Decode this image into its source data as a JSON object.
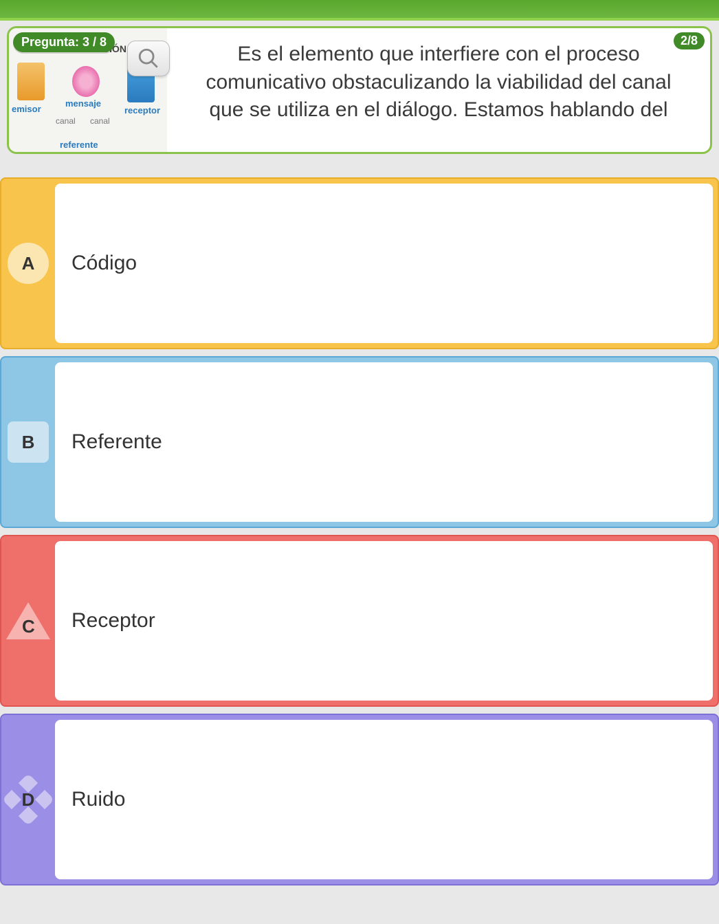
{
  "header": {
    "question_badge": "Pregunta: 3 / 8",
    "count_badge": "2/8"
  },
  "question": {
    "text": "Es el elemento que interfiere con el proceso comunicativo obstaculizando la viabilidad del canal que se utiliza en el diálogo. Estamos hablando del",
    "image": {
      "title": "COMUNICACIÓN",
      "labels": {
        "emisor": "emisor",
        "mensaje": "mensaje",
        "receptor": "receptor",
        "referente": "referente",
        "canal1": "canal",
        "canal2": "canal"
      }
    }
  },
  "answers": [
    {
      "letter": "A",
      "text": "Código"
    },
    {
      "letter": "B",
      "text": "Referente"
    },
    {
      "letter": "C",
      "text": "Receptor"
    },
    {
      "letter": "D",
      "text": "Ruido"
    }
  ]
}
